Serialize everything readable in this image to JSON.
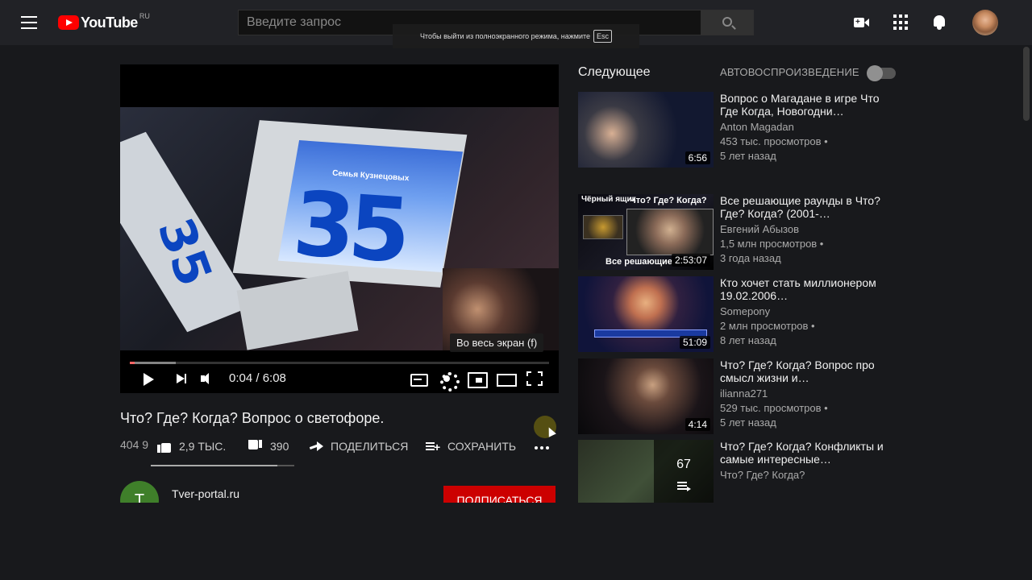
{
  "header": {
    "logo_text": "YouTube",
    "logo_region": "RU",
    "search_placeholder": "Введите запрос",
    "fullscreen_toast": "Чтобы выйти из полноэкранного режима, нажмите",
    "fullscreen_key": "Esc"
  },
  "player": {
    "frame_text": "Семья Кузнецовых",
    "frame_number": "35",
    "tooltip": "Во весь экран (f)",
    "time": "0:04 / 6:08",
    "progress_played_fraction": 0.011,
    "progress_buffered_fraction": 0.11
  },
  "video": {
    "title": "Что? Где? Когда? Вопрос о светофоре.",
    "views": "404 9",
    "likes": "2,9 ТЫС.",
    "dislikes": "390",
    "share_label": "ПОДЕЛИТЬСЯ",
    "save_label": "СОХРАНИТЬ",
    "like_ratio_fraction": 0.88
  },
  "channel": {
    "avatar_letter": "T",
    "name": "Tver-portal.ru",
    "subscribe_label": "ПОДПИСАТЬСЯ"
  },
  "sidebar": {
    "next_label": "Следующее",
    "autoplay_label": "АВТОВОСПРОИЗВЕДЕНИЕ",
    "autoplay_on": false,
    "recommendations": [
      {
        "title": "Вопрос о Магадане в игре Что Где Когда, Новогодни…",
        "channel": "Anton Magadan",
        "views": "453 тыс. просмотров •",
        "age": "5 лет назад",
        "duration": "6:56"
      },
      {
        "title": "Все решающие раунды в Что? Где? Когда? (2001-…",
        "channel": "Евгений Абызов",
        "views": "1,5 млн просмотров •",
        "age": "3 года назад",
        "duration": "2:53:07",
        "thumb_badge": "Чёрный ящик",
        "thumb_headline": "Что? Где? Когда?",
        "thumb_bottom": "Все решающие"
      },
      {
        "title": "Кто хочет стать миллионером 19.02.2006…",
        "channel": "Somepony",
        "views": "2 млн просмотров •",
        "age": "8 лет назад",
        "duration": "51:09"
      },
      {
        "title": "Что? Где? Когда? Вопрос про смысл жизни и…",
        "channel": "ilianna271",
        "views": "529 тыс. просмотров •",
        "age": "5 лет назад",
        "duration": "4:14"
      },
      {
        "title": "Что? Где? Когда? Конфликты и самые интересные…",
        "channel": "Что? Где? Когда?",
        "playlist_count": "67"
      }
    ]
  }
}
